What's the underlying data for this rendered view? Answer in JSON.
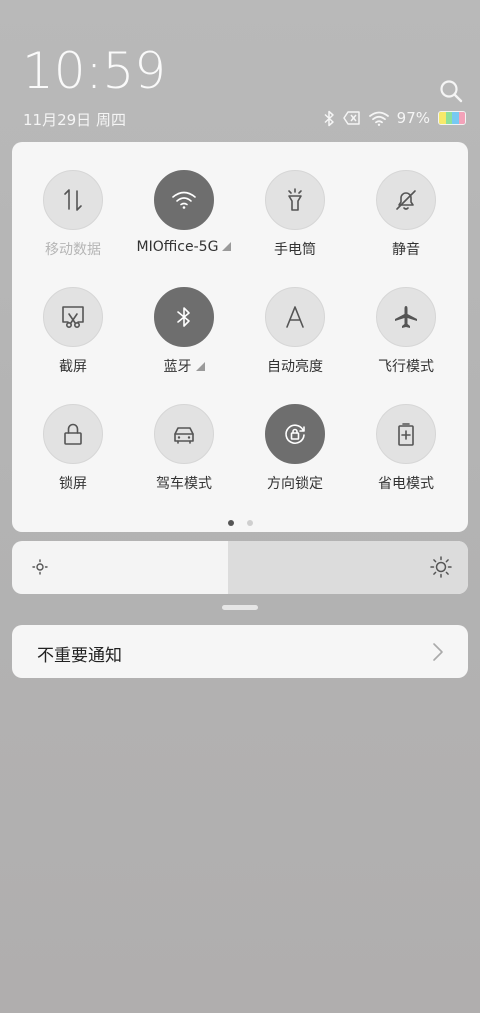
{
  "status": {
    "time": "10:59",
    "date": "11月29日 周四",
    "battery_percent": "97%",
    "battery_level": 0.97,
    "battery_colors": [
      "#f7e96a",
      "#8ee09a",
      "#77c9f2",
      "#f3a2b9"
    ]
  },
  "tiles": [
    {
      "label": "移动数据",
      "icon": "mobile-data-icon",
      "active": false,
      "dim": true
    },
    {
      "label": "MIOffice-5G",
      "icon": "wifi-icon",
      "active": true,
      "dim": false
    },
    {
      "label": "手电筒",
      "icon": "flashlight-icon",
      "active": false,
      "dim": false
    },
    {
      "label": "静音",
      "icon": "bell-off-icon",
      "active": false,
      "dim": false
    },
    {
      "label": "截屏",
      "icon": "screenshot-icon",
      "active": false,
      "dim": false
    },
    {
      "label": "蓝牙",
      "icon": "bluetooth-icon",
      "active": true,
      "dim": false
    },
    {
      "label": "自动亮度",
      "icon": "auto-brightness-icon",
      "active": false,
      "dim": false
    },
    {
      "label": "飞行模式",
      "icon": "airplane-icon",
      "active": false,
      "dim": false
    },
    {
      "label": "锁屏",
      "icon": "lock-icon",
      "active": false,
      "dim": false
    },
    {
      "label": "驾车模式",
      "icon": "car-icon",
      "active": false,
      "dim": false
    },
    {
      "label": "方向锁定",
      "icon": "rotation-lock-icon",
      "active": true,
      "dim": false
    },
    {
      "label": "省电模式",
      "icon": "battery-saver-icon",
      "active": false,
      "dim": false
    }
  ],
  "pager": {
    "pages": 2,
    "current": 1
  },
  "brightness": {
    "level": 0.5
  },
  "notification": {
    "label": "不重要通知"
  }
}
